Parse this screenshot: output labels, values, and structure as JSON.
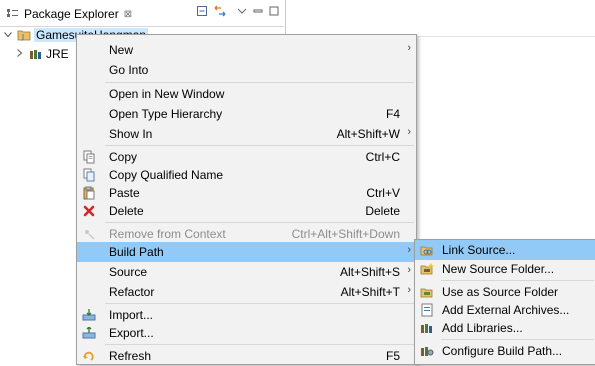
{
  "view": {
    "title": "Package Explorer",
    "close_glyph": "⊠",
    "toolbar_icons": [
      "collapse-all-icon",
      "link-with-editor-icon",
      "view-menu-icon",
      "minimize-icon",
      "maximize-icon"
    ]
  },
  "tree": {
    "project_label": "GamesuiteHangman",
    "child_label": "JRE"
  },
  "context_menu": {
    "items": [
      {
        "label": "New",
        "shortcut": "",
        "submenu": true
      },
      {
        "label": "Go Into",
        "shortcut": "",
        "submenu": false
      },
      {
        "label": "Open in New Window",
        "shortcut": "",
        "submenu": false
      },
      {
        "label": "Open Type Hierarchy",
        "shortcut": "F4",
        "submenu": false
      },
      {
        "label": "Show In",
        "shortcut": "Alt+Shift+W",
        "submenu": true
      },
      {
        "label": "Copy",
        "shortcut": "Ctrl+C",
        "icon": "copy-icon"
      },
      {
        "label": "Copy Qualified Name",
        "shortcut": "",
        "icon": "copy-qualified-name-icon"
      },
      {
        "label": "Paste",
        "shortcut": "Ctrl+V",
        "icon": "paste-icon"
      },
      {
        "label": "Delete",
        "shortcut": "Delete",
        "icon": "delete-icon"
      },
      {
        "label": "Remove from Context",
        "shortcut": "Ctrl+Alt+Shift+Down",
        "icon": "remove-from-context-icon",
        "disabled": true
      },
      {
        "label": "Build Path",
        "shortcut": "",
        "submenu": true,
        "highlighted": true
      },
      {
        "label": "Source",
        "shortcut": "Alt+Shift+S",
        "submenu": true
      },
      {
        "label": "Refactor",
        "shortcut": "Alt+Shift+T",
        "submenu": true
      },
      {
        "label": "Import...",
        "shortcut": "",
        "icon": "import-icon"
      },
      {
        "label": "Export...",
        "shortcut": "",
        "icon": "export-icon"
      },
      {
        "label": "Refresh",
        "shortcut": "F5",
        "icon": "refresh-icon"
      }
    ]
  },
  "build_path_submenu": {
    "items": [
      {
        "label": "Link Source...",
        "icon": "link-source-icon",
        "highlighted": true
      },
      {
        "label": "New Source Folder...",
        "icon": "new-source-folder-icon"
      },
      {
        "label": "Use as Source Folder",
        "icon": "use-as-source-folder-icon"
      },
      {
        "label": "Add External Archives...",
        "icon": "add-external-archives-icon"
      },
      {
        "label": "Add Libraries...",
        "icon": "add-libraries-icon"
      },
      {
        "label": "Configure Build Path...",
        "icon": "configure-build-path-icon"
      }
    ]
  },
  "colors": {
    "highlight": "#91c9f7",
    "menu_bg": "#f2f2f2",
    "selection": "#cce8ff"
  }
}
